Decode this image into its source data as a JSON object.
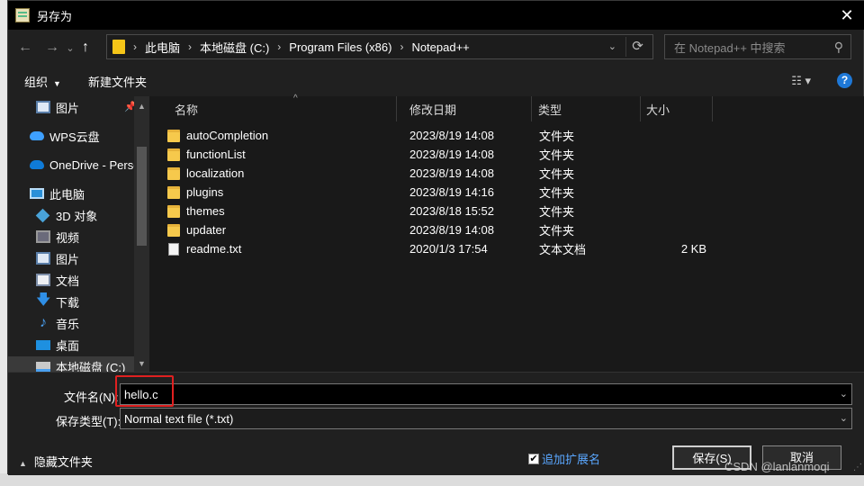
{
  "window": {
    "title": "另存为",
    "close_glyph": "✕"
  },
  "nav": {
    "back": "←",
    "forward": "→",
    "dropdown": "⌄",
    "up": "↑",
    "refresh": "⟳"
  },
  "breadcrumbs": [
    "此电脑",
    "本地磁盘 (C:)",
    "Program Files (x86)",
    "Notepad++"
  ],
  "search": {
    "placeholder": "在 Notepad++ 中搜索"
  },
  "toolbar": {
    "organize": "组织",
    "new_folder": "新建文件夹",
    "help": "?"
  },
  "sidebar": {
    "items": [
      {
        "label": "图片",
        "icon": "pictures-icon"
      },
      {
        "label": "WPS云盘",
        "icon": "wps-cloud-icon"
      },
      {
        "label": "OneDrive - Personal",
        "icon": "onedrive-icon"
      },
      {
        "label": "此电脑",
        "icon": "this-pc-icon"
      },
      {
        "label": "3D 对象",
        "icon": "3d-objects-icon"
      },
      {
        "label": "视频",
        "icon": "videos-icon"
      },
      {
        "label": "图片",
        "icon": "pictures-icon"
      },
      {
        "label": "文档",
        "icon": "documents-icon"
      },
      {
        "label": "下载",
        "icon": "downloads-icon"
      },
      {
        "label": "音乐",
        "icon": "music-icon"
      },
      {
        "label": "桌面",
        "icon": "desktop-icon"
      },
      {
        "label": "本地磁盘 (C:)",
        "icon": "local-disk-icon"
      }
    ]
  },
  "columns": {
    "name": "名称",
    "date": "修改日期",
    "type": "类型",
    "size": "大小"
  },
  "files": [
    {
      "name": "autoCompletion",
      "date": "2023/8/19 14:08",
      "type": "文件夹",
      "size": "",
      "icon": "folder-icon"
    },
    {
      "name": "functionList",
      "date": "2023/8/19 14:08",
      "type": "文件夹",
      "size": "",
      "icon": "folder-icon"
    },
    {
      "name": "localization",
      "date": "2023/8/19 14:08",
      "type": "文件夹",
      "size": "",
      "icon": "folder-icon"
    },
    {
      "name": "plugins",
      "date": "2023/8/19 14:16",
      "type": "文件夹",
      "size": "",
      "icon": "folder-icon"
    },
    {
      "name": "themes",
      "date": "2023/8/18 15:52",
      "type": "文件夹",
      "size": "",
      "icon": "folder-icon"
    },
    {
      "name": "updater",
      "date": "2023/8/19 14:08",
      "type": "文件夹",
      "size": "",
      "icon": "folder-icon"
    },
    {
      "name": "readme.txt",
      "date": "2020/1/3 17:54",
      "type": "文本文档",
      "size": "2 KB",
      "icon": "text-file-icon"
    }
  ],
  "form": {
    "filename_label": "文件名(N):",
    "filename_value": "hello.c",
    "filetype_label": "保存类型(T):",
    "filetype_value": "Normal text file (*.txt)"
  },
  "footer": {
    "hide_folders": "隐藏文件夹",
    "append_ext": "追加扩展名",
    "append_ext_checked": true,
    "save": "保存(S)",
    "cancel": "取消"
  },
  "watermark": "CSDN @lanlanmoqi",
  "colors": {
    "highlight": "#e02020",
    "accent": "#1e78d7",
    "folder": "#f6c94c"
  }
}
